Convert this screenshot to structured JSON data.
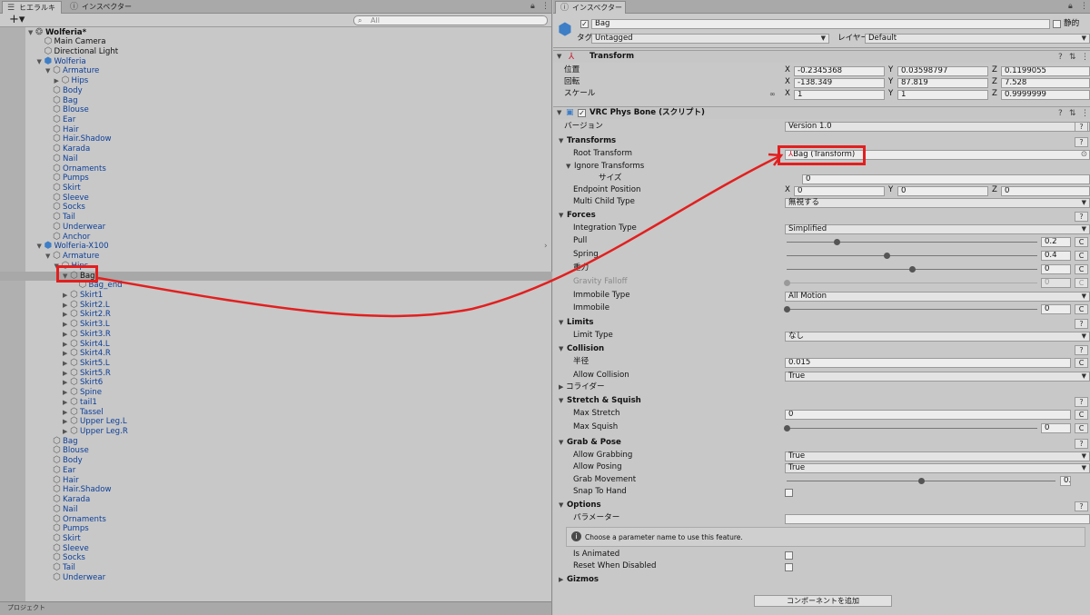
{
  "hierarchy": {
    "tab_label": "ヒエラルキー",
    "search_placeholder": "All",
    "bottom_tab": "プロジェクト",
    "rows": [
      {
        "label": "Wolferia*",
        "indent": 0,
        "arrow": "▼",
        "icon": "scene",
        "bold": true
      },
      {
        "label": "Main Camera",
        "indent": 1,
        "arrow": "",
        "icon": "cube"
      },
      {
        "label": "Directional Light",
        "indent": 1,
        "arrow": "",
        "icon": "cube"
      },
      {
        "label": "Wolferia",
        "indent": 1,
        "arrow": "▼",
        "icon": "prefab",
        "blue": true
      },
      {
        "label": "Armature",
        "indent": 2,
        "arrow": "▼",
        "icon": "cube",
        "blue": true
      },
      {
        "label": "Hips",
        "indent": 3,
        "arrow": "▶",
        "icon": "cube",
        "blue": true
      },
      {
        "label": "Body",
        "indent": 2,
        "arrow": "",
        "icon": "cube",
        "blue": true
      },
      {
        "label": "Bag",
        "indent": 2,
        "arrow": "",
        "icon": "cube",
        "blue": true
      },
      {
        "label": "Blouse",
        "indent": 2,
        "arrow": "",
        "icon": "cube",
        "blue": true
      },
      {
        "label": "Ear",
        "indent": 2,
        "arrow": "",
        "icon": "cube",
        "blue": true
      },
      {
        "label": "Hair",
        "indent": 2,
        "arrow": "",
        "icon": "cube",
        "blue": true
      },
      {
        "label": "Hair.Shadow",
        "indent": 2,
        "arrow": "",
        "icon": "cube",
        "blue": true
      },
      {
        "label": "Karada",
        "indent": 2,
        "arrow": "",
        "icon": "cube",
        "blue": true
      },
      {
        "label": "Nail",
        "indent": 2,
        "arrow": "",
        "icon": "cube",
        "blue": true
      },
      {
        "label": "Ornaments",
        "indent": 2,
        "arrow": "",
        "icon": "cube",
        "blue": true
      },
      {
        "label": "Pumps",
        "indent": 2,
        "arrow": "",
        "icon": "cube",
        "blue": true
      },
      {
        "label": "Skirt",
        "indent": 2,
        "arrow": "",
        "icon": "cube",
        "blue": true
      },
      {
        "label": "Sleeve",
        "indent": 2,
        "arrow": "",
        "icon": "cube",
        "blue": true
      },
      {
        "label": "Socks",
        "indent": 2,
        "arrow": "",
        "icon": "cube",
        "blue": true
      },
      {
        "label": "Tail",
        "indent": 2,
        "arrow": "",
        "icon": "cube",
        "blue": true
      },
      {
        "label": "Underwear",
        "indent": 2,
        "arrow": "",
        "icon": "cube",
        "blue": true
      },
      {
        "label": "Anchor",
        "indent": 2,
        "arrow": "",
        "icon": "cube",
        "blue": true
      },
      {
        "label": "Wolferia-X100",
        "indent": 1,
        "arrow": "▼",
        "icon": "prefab",
        "blue": true,
        "chev": true
      },
      {
        "label": "Armature",
        "indent": 2,
        "arrow": "▼",
        "icon": "cube",
        "blue": true
      },
      {
        "label": "Hips",
        "indent": 3,
        "arrow": "▼",
        "icon": "cube",
        "blue": true
      },
      {
        "label": "Bag",
        "indent": 4,
        "arrow": "▼",
        "icon": "cube",
        "selected": true
      },
      {
        "label": "Bag_end",
        "indent": 5,
        "arrow": "",
        "icon": "cube",
        "blue": true
      },
      {
        "label": "Skirt1",
        "indent": 4,
        "arrow": "▶",
        "icon": "cube",
        "blue": true
      },
      {
        "label": "Skirt2.L",
        "indent": 4,
        "arrow": "▶",
        "icon": "cube",
        "blue": true
      },
      {
        "label": "Skirt2.R",
        "indent": 4,
        "arrow": "▶",
        "icon": "cube",
        "blue": true
      },
      {
        "label": "Skirt3.L",
        "indent": 4,
        "arrow": "▶",
        "icon": "cube",
        "blue": true
      },
      {
        "label": "Skirt3.R",
        "indent": 4,
        "arrow": "▶",
        "icon": "cube",
        "blue": true
      },
      {
        "label": "Skirt4.L",
        "indent": 4,
        "arrow": "▶",
        "icon": "cube",
        "blue": true
      },
      {
        "label": "Skirt4.R",
        "indent": 4,
        "arrow": "▶",
        "icon": "cube",
        "blue": true
      },
      {
        "label": "Skirt5.L",
        "indent": 4,
        "arrow": "▶",
        "icon": "cube",
        "blue": true
      },
      {
        "label": "Skirt5.R",
        "indent": 4,
        "arrow": "▶",
        "icon": "cube",
        "blue": true
      },
      {
        "label": "Skirt6",
        "indent": 4,
        "arrow": "▶",
        "icon": "cube",
        "blue": true
      },
      {
        "label": "Spine",
        "indent": 4,
        "arrow": "▶",
        "icon": "cube",
        "blue": true
      },
      {
        "label": "tail1",
        "indent": 4,
        "arrow": "▶",
        "icon": "cube",
        "blue": true
      },
      {
        "label": "Tassel",
        "indent": 4,
        "arrow": "▶",
        "icon": "cube",
        "blue": true
      },
      {
        "label": "Upper Leg.L",
        "indent": 4,
        "arrow": "▶",
        "icon": "cube",
        "blue": true
      },
      {
        "label": "Upper Leg.R",
        "indent": 4,
        "arrow": "▶",
        "icon": "cube",
        "blue": true
      },
      {
        "label": "Bag",
        "indent": 2,
        "arrow": "",
        "icon": "cube",
        "blue": true
      },
      {
        "label": "Blouse",
        "indent": 2,
        "arrow": "",
        "icon": "cube",
        "blue": true
      },
      {
        "label": "Body",
        "indent": 2,
        "arrow": "",
        "icon": "cube",
        "blue": true
      },
      {
        "label": "Ear",
        "indent": 2,
        "arrow": "",
        "icon": "cube",
        "blue": true
      },
      {
        "label": "Hair",
        "indent": 2,
        "arrow": "",
        "icon": "cube",
        "blue": true
      },
      {
        "label": "Hair.Shadow",
        "indent": 2,
        "arrow": "",
        "icon": "cube",
        "blue": true
      },
      {
        "label": "Karada",
        "indent": 2,
        "arrow": "",
        "icon": "cube",
        "blue": true
      },
      {
        "label": "Nail",
        "indent": 2,
        "arrow": "",
        "icon": "cube",
        "blue": true
      },
      {
        "label": "Ornaments",
        "indent": 2,
        "arrow": "",
        "icon": "cube",
        "blue": true
      },
      {
        "label": "Pumps",
        "indent": 2,
        "arrow": "",
        "icon": "cube",
        "blue": true
      },
      {
        "label": "Skirt",
        "indent": 2,
        "arrow": "",
        "icon": "cube",
        "blue": true
      },
      {
        "label": "Sleeve",
        "indent": 2,
        "arrow": "",
        "icon": "cube",
        "blue": true
      },
      {
        "label": "Socks",
        "indent": 2,
        "arrow": "",
        "icon": "cube",
        "blue": true
      },
      {
        "label": "Tail",
        "indent": 2,
        "arrow": "",
        "icon": "cube",
        "blue": true
      },
      {
        "label": "Underwear",
        "indent": 2,
        "arrow": "",
        "icon": "cube",
        "blue": true
      }
    ]
  },
  "inspector": {
    "tab_label": "インスペクター",
    "object_name": "Bag",
    "static_label": "静的",
    "tag_label": "タグ",
    "tag_value": "Untagged",
    "layer_label": "レイヤー",
    "layer_value": "Default",
    "transform": {
      "title": "Transform",
      "position_label": "位置",
      "rotation_label": "回転",
      "scale_label": "スケール",
      "pos": {
        "x": "-0.2345368",
        "y": "0.03598797",
        "z": "0.1199055"
      },
      "rot": {
        "x": "-138.349",
        "y": "87.819",
        "z": "7.528"
      },
      "scl": {
        "x": "1",
        "y": "1",
        "z": "0.9999999"
      }
    },
    "physbone": {
      "title": "VRC Phys Bone (スクリプト)",
      "version_label": "バージョン",
      "version_value": "Version 1.0",
      "transforms_header": "Transforms",
      "root_transform_label": "Root Transform",
      "root_transform_value": "Bag (Transform)",
      "ignore_transforms_label": "Ignore Transforms",
      "size_label": "サイズ",
      "size_value": "0",
      "endpoint_label": "Endpoint Position",
      "endpoint": {
        "x": "0",
        "y": "0",
        "z": "0"
      },
      "multichild_label": "Multi Child Type",
      "multichild_value": "無視する",
      "forces_header": "Forces",
      "integration_label": "Integration Type",
      "integration_value": "Simplified",
      "pull_label": "Pull",
      "pull_value": "0.2",
      "spring_label": "Spring",
      "spring_value": "0.4",
      "gravity_label": "重力",
      "gravity_value": "0",
      "gravity_falloff_label": "Gravity Falloff",
      "gravity_falloff_value": "0",
      "immobile_type_label": "Immobile Type",
      "immobile_type_value": "All Motion",
      "immobile_label": "Immobile",
      "immobile_value": "0",
      "limits_header": "Limits",
      "limit_type_label": "Limit Type",
      "limit_type_value": "なし",
      "collision_header": "Collision",
      "radius_label": "半径",
      "radius_value": "0.015",
      "allow_collision_label": "Allow Collision",
      "allow_collision_value": "True",
      "colliders_label": "コライダー",
      "stretch_header": "Stretch & Squish",
      "max_stretch_label": "Max Stretch",
      "max_stretch_value": "0",
      "max_squish_label": "Max Squish",
      "max_squish_value": "0",
      "grab_header": "Grab & Pose",
      "allow_grabbing_label": "Allow Grabbing",
      "allow_grabbing_value": "True",
      "allow_posing_label": "Allow Posing",
      "allow_posing_value": "True",
      "grab_movement_label": "Grab Movement",
      "grab_movement_value": "0.5",
      "snap_label": "Snap To Hand",
      "options_header": "Options",
      "parameter_label": "パラメーター",
      "info_text": "Choose a parameter name to use this feature.",
      "is_animated_label": "Is Animated",
      "reset_label": "Reset When Disabled",
      "gizmos_header": "Gizmos"
    },
    "add_component_label": "コンポーネントを追加",
    "axis": {
      "x": "X",
      "y": "Y",
      "z": "Z"
    },
    "help": "?",
    "c": "C"
  },
  "sliders": {
    "pull": 0.2,
    "spring": 0.4,
    "gravity": 0.5,
    "gravity_falloff": 0,
    "immobile": 0,
    "max_squish": 0,
    "grab_movement": 0.5
  },
  "annotation_color": "#e21f1f"
}
